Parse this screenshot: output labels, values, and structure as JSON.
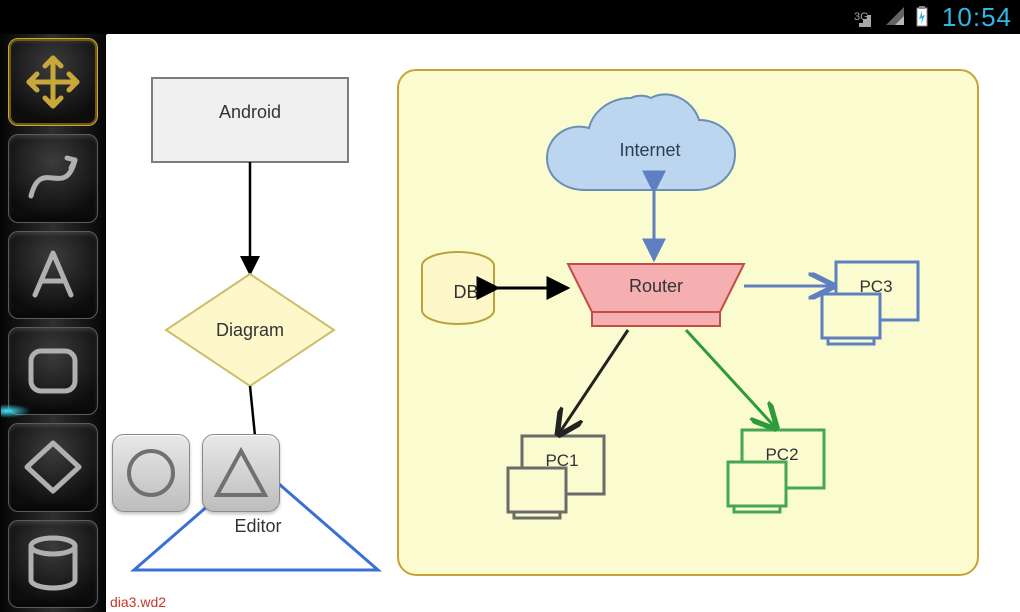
{
  "statusbar": {
    "network_label": "3G",
    "time": "10:54"
  },
  "toolbar": {
    "move": {
      "name": "move"
    },
    "curve": {
      "name": "curve"
    },
    "text": {
      "name": "text",
      "glyph": "A"
    },
    "square": {
      "name": "rounded-square"
    },
    "diamond": {
      "name": "diamond"
    },
    "cylinder": {
      "name": "cylinder"
    }
  },
  "floating_palette": {
    "circle": {
      "name": "circle"
    },
    "triangle": {
      "name": "triangle"
    }
  },
  "file": {
    "name": "dia3.wd2"
  },
  "diagram": {
    "flow": {
      "box_android": "Android",
      "diamond_diagram": "Diagram",
      "triangle_editor": "Editor"
    },
    "network": {
      "internet": "Internet",
      "db": "DB",
      "router": "Router",
      "pc1": "PC1",
      "pc2": "PC2",
      "pc3": "PC3"
    }
  }
}
